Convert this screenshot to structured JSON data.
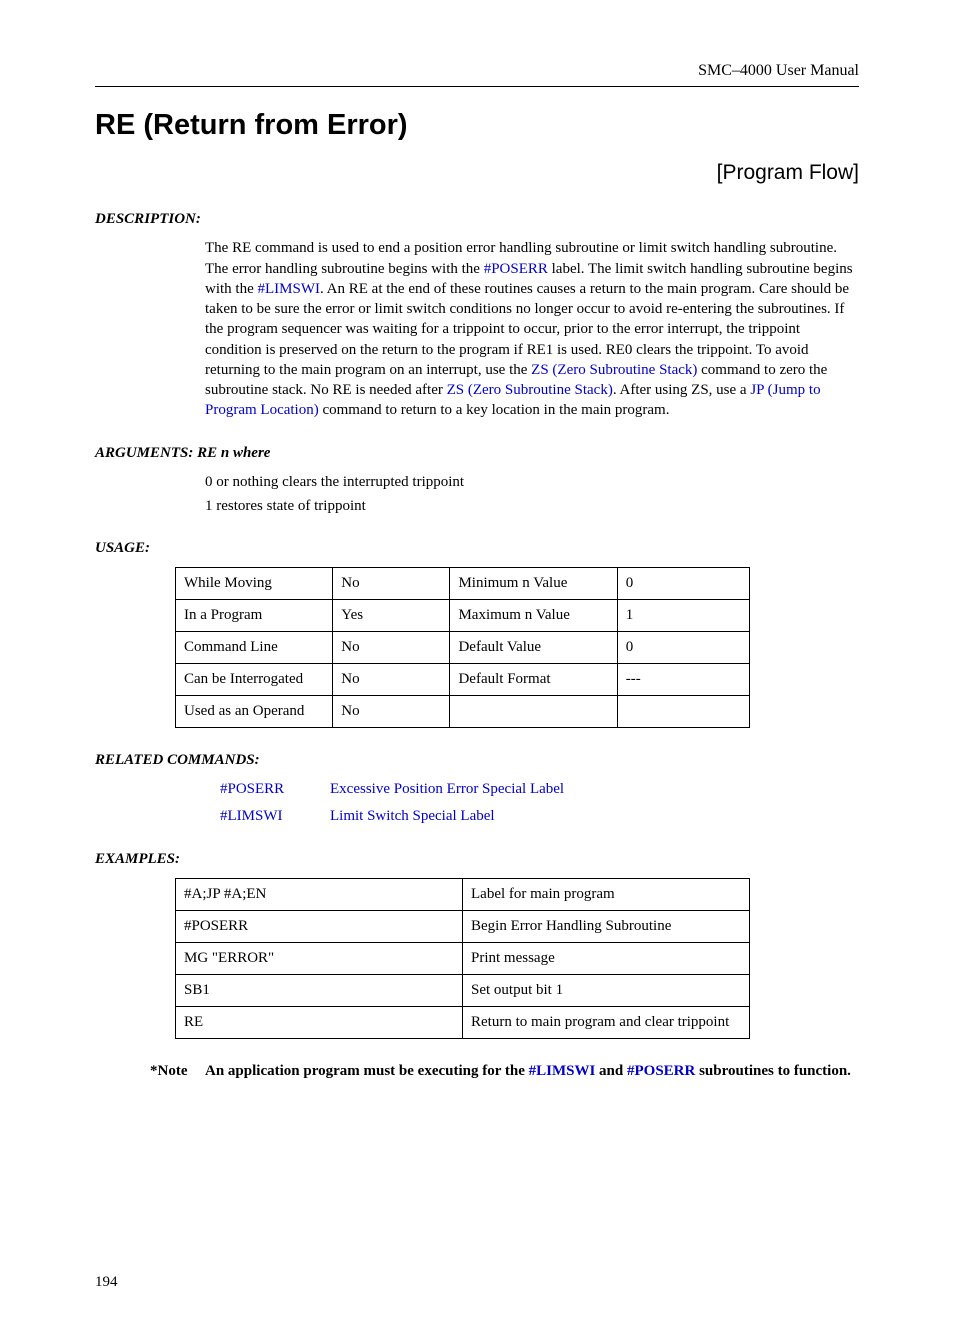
{
  "header": {
    "manual": "SMC–4000 User Manual"
  },
  "title": "RE (Return from Error)",
  "category": "[Program Flow]",
  "sections": {
    "description_label": "DESCRIPTION:",
    "arguments_label": "ARGUMENTS:  RE n          where",
    "usage_label": "USAGE:",
    "related_label": "RELATED COMMANDS:",
    "examples_label": "EXAMPLES:"
  },
  "description": {
    "p1a": "The RE command is used to end a position error handling subroutine or limit switch handling subroutine. The error handling subroutine begins with the ",
    "link1": "#POSERR",
    "p1b": " label. The limit switch handling subroutine begins with the ",
    "link2": "#LIMSWI",
    "p1c": ". An RE at the end of these routines causes a return to the main program. Care should be taken to be sure the error or limit switch conditions no longer occur to avoid re-entering the subroutines. If the program sequencer was waiting for a trippoint to occur, prior to the error interrupt, the trippoint condition is preserved on the return to the program if RE1 is used. RE0 clears the trippoint. To avoid returning to the main program on an interrupt, use the ",
    "link3": "ZS (Zero Subroutine Stack)",
    "p1d": " command to zero the subroutine stack. No RE is needed after ",
    "link4": "ZS (Zero Subroutine Stack)",
    "p1e": ". After using ZS, use a ",
    "link5": "JP (Jump to Program Location)",
    "p1f": " command to return to a key location in the main program."
  },
  "arguments": {
    "line1": "0 or nothing clears the interrupted trippoint",
    "line2": "1 restores state of trippoint"
  },
  "usage_table": [
    [
      "While Moving",
      "No",
      "Minimum n Value",
      "0"
    ],
    [
      "In a Program",
      "Yes",
      "Maximum n Value",
      "1"
    ],
    [
      "Command Line",
      "No",
      "Default Value",
      "0"
    ],
    [
      "Can be Interrogated",
      "No",
      "Default Format",
      "---"
    ],
    [
      "Used as an Operand",
      "No",
      "",
      ""
    ]
  ],
  "related": [
    {
      "label": "#POSERR",
      "desc": "Excessive Position Error Special Label"
    },
    {
      "label": "#LIMSWI",
      "desc": "Limit Switch Special Label"
    }
  ],
  "examples_table": [
    [
      "#A;JP #A;EN",
      "Label for main program"
    ],
    [
      "#POSERR",
      "Begin Error Handling Subroutine"
    ],
    [
      "MG \"ERROR\"",
      "Print message"
    ],
    [
      "SB1",
      "Set output bit 1"
    ],
    [
      "RE",
      "Return to main program and clear trippoint"
    ]
  ],
  "note": {
    "label": "*Note",
    "t1": "An application program must be executing for the ",
    "link1": "#LIMSWI",
    "t2": " and ",
    "link2": "#POSERR",
    "t3": " subroutines to function."
  },
  "page": "194"
}
